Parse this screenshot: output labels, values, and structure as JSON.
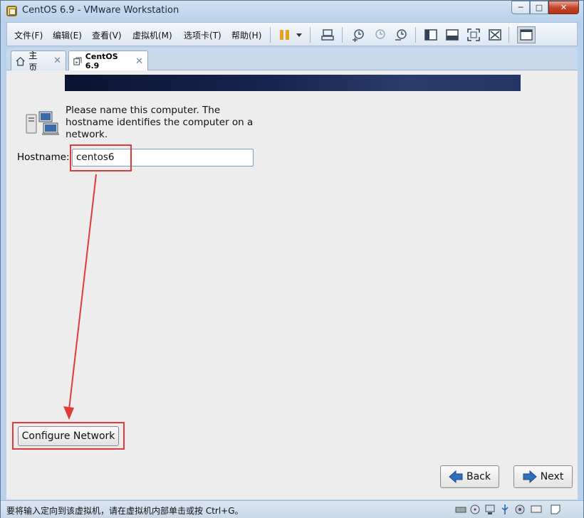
{
  "window": {
    "title": "CentOS 6.9 - VMware Workstation",
    "controls": {
      "minimize": "─",
      "maximize": "□",
      "close": "✕"
    }
  },
  "menu": {
    "items": [
      "文件(F)",
      "编辑(E)",
      "查看(V)",
      "虚拟机(M)",
      "选项卡(T)",
      "帮助(H)"
    ]
  },
  "toolbar": {
    "icons": [
      "pause-icon",
      "dropdown-icon",
      "send-keys-icon",
      "snapshot-take-icon",
      "snapshot-revert-icon",
      "snapshot-manager-icon",
      "console-view-icon",
      "unity-icon",
      "fullscreen-icon",
      "stretch-icon",
      "library-icon"
    ]
  },
  "tabs": [
    {
      "label": "主页",
      "icon": "home-icon",
      "close": "✕"
    },
    {
      "label": "CentOS 6.9",
      "icon": "vm-icon",
      "close": "✕"
    }
  ],
  "installer": {
    "intro": "Please name this computer.  The hostname identifies the computer on a network.",
    "hostname_label": "Hostname:",
    "hostname_value": "centos6",
    "configure_network": "Configure Network",
    "back": "Back",
    "next": "Next"
  },
  "annotation": {
    "color": "#e03a3a"
  },
  "status": {
    "text": "要将输入定向到该虚拟机，请在虚拟机内部单击或按 Ctrl+G。",
    "icons": [
      "hdd-icon",
      "cd-icon",
      "network-icon",
      "usb-icon",
      "sound-icon",
      "display-icon",
      "message-icon"
    ]
  }
}
